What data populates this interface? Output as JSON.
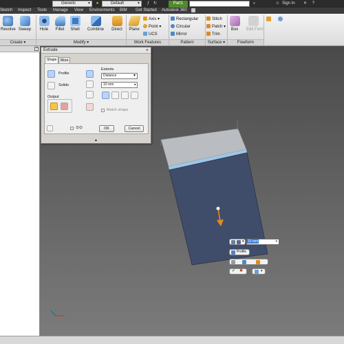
{
  "qat": {
    "material": "Generic",
    "appearance": "Default",
    "document_tab": "Part1",
    "sign_in": "Sign In"
  },
  "tabs": [
    "Sketch",
    "Inspect",
    "Tools",
    "Manage",
    "View",
    "Environments",
    "BIM",
    "Get Started",
    "Autodesk 360"
  ],
  "ribbon": {
    "create_buttons": [
      "Revolve",
      "Sweep"
    ],
    "modify_buttons": [
      "Hole",
      "Fillet",
      "Shell",
      "Combine",
      "Direct"
    ],
    "work_features": {
      "plane": "Plane",
      "axis": "Axis",
      "point": "Point",
      "ucs": "UCS"
    },
    "pattern": {
      "rectangular": "Rectangular",
      "circular": "Circular",
      "mirror": "Mirror"
    },
    "surface": {
      "stitch": "Stitch",
      "patch": "Patch",
      "trim": "Trim"
    },
    "freeform": {
      "box": "Box",
      "edit_form": "Edit Form"
    },
    "panels": {
      "create": "Create",
      "modify": "Modify",
      "work_features": "Work Features",
      "pattern": "Pattern",
      "surface": "Surface",
      "freeform": "Freeform"
    }
  },
  "dialog": {
    "title": "Extrude",
    "tabs": [
      "Shape",
      "More"
    ],
    "profile_label": "Profile",
    "solids_label": "Solids",
    "output_label": "Output",
    "extents_label": "Extents",
    "extents_value": "Distance",
    "distance_value": "10 mm",
    "match_shape_label": "Match shape",
    "ok_label": "OK",
    "cancel_label": "Cancel",
    "expand_symbol": "▲"
  },
  "mini_toolbar": {
    "distance_value": "10 mm",
    "profile_label": "Profile"
  },
  "colors": {
    "viewport_top": "#4a4a4a",
    "viewport_bottom": "#7b7b7b",
    "part_tab": "#4f8b2a",
    "sketch_fill": "#3f4d6b",
    "extrude_arrow": "#e48a1c"
  }
}
